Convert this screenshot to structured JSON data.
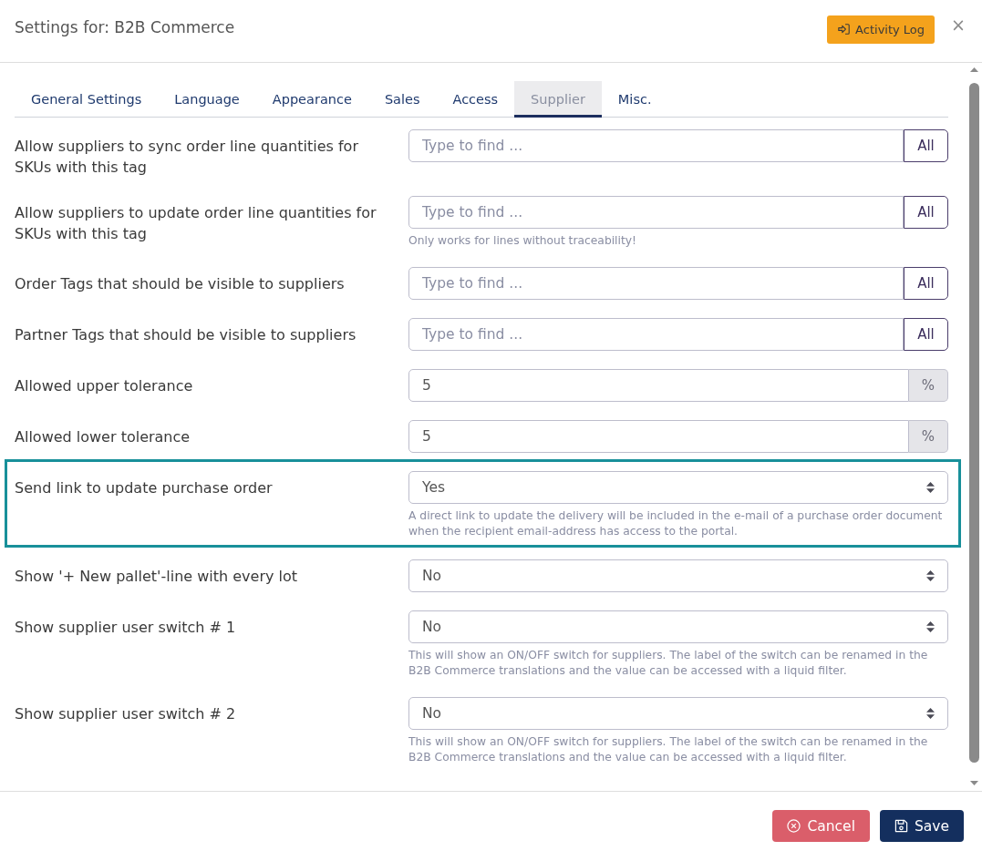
{
  "dialog": {
    "title": "Settings for: B2B Commerce",
    "activity_log_button": "Activity Log",
    "close_button": "×"
  },
  "tabs": [
    {
      "label": "General Settings",
      "selected": false
    },
    {
      "label": "Language",
      "selected": false
    },
    {
      "label": "Appearance",
      "selected": false
    },
    {
      "label": "Sales",
      "selected": false
    },
    {
      "label": "Access",
      "selected": false
    },
    {
      "label": "Supplier",
      "selected": true
    },
    {
      "label": "Misc.",
      "selected": false
    }
  ],
  "settings": [
    {
      "kind": "tag_search",
      "label": "Allow suppliers to sync order line quantities for SKUs with this tag",
      "placeholder": "Type to find ...",
      "button": "All",
      "highlighted": false
    },
    {
      "kind": "tag_search",
      "label": "Allow suppliers to update order line quantities for SKUs with this tag",
      "placeholder": "Type to find ...",
      "button": "All",
      "help": "Only works for lines without traceability!",
      "highlighted": false
    },
    {
      "kind": "tag_search",
      "label": "Order Tags that should be visible to suppliers",
      "placeholder": "Type to find ...",
      "button": "All",
      "highlighted": false
    },
    {
      "kind": "tag_search",
      "label": "Partner Tags that should be visible to suppliers",
      "placeholder": "Type to find ...",
      "button": "All",
      "highlighted": false
    },
    {
      "kind": "number",
      "label": "Allowed upper tolerance",
      "value": "5",
      "unit": "%",
      "highlighted": false
    },
    {
      "kind": "number",
      "label": "Allowed lower tolerance",
      "value": "5",
      "unit": "%",
      "highlighted": false
    },
    {
      "kind": "select",
      "label": "Send link to update purchase order",
      "value": "Yes",
      "help": "A direct link to update the delivery will be included in the e-mail of a purchase order document when the recipient email-address has access to the portal.",
      "highlighted": true
    },
    {
      "kind": "select",
      "label": "Show '+ New pallet'-line with every lot",
      "value": "No",
      "highlighted": false
    },
    {
      "kind": "select",
      "label": "Show supplier user switch # 1",
      "value": "No",
      "help": "This will show an ON/OFF switch for suppliers. The label of the switch can be renamed in the B2B Commerce translations and the value can be accessed with a liquid filter.",
      "highlighted": false
    },
    {
      "kind": "select",
      "label": "Show supplier user switch # 2",
      "value": "No",
      "help": "This will show an ON/OFF switch for suppliers. The label of the switch can be renamed in the B2B Commerce translations and the value can be accessed with a liquid filter.",
      "highlighted": false
    }
  ],
  "footer": {
    "buttons": [
      {
        "kind": "cancel",
        "label": "Cancel"
      },
      {
        "kind": "save",
        "label": "Save"
      }
    ]
  }
}
